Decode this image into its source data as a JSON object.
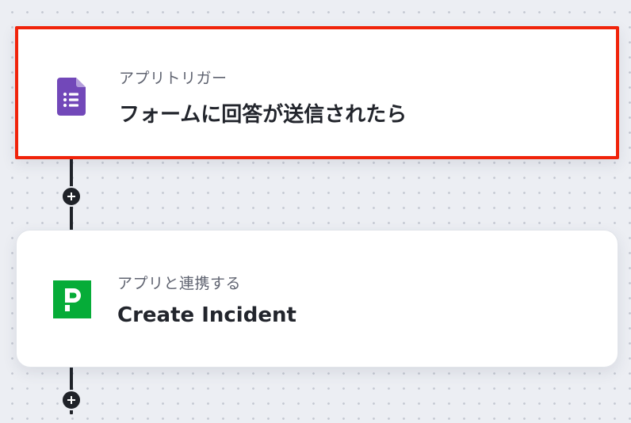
{
  "workflow": {
    "steps": [
      {
        "subtitle": "アプリトリガー",
        "title": "フォームに回答が送信されたら",
        "icon": "google-forms-icon",
        "icon_color": "#7248b9",
        "highlight_color": "#f0230a"
      },
      {
        "subtitle": "アプリと連携する",
        "title": "Create Incident",
        "icon": "pagerduty-icon",
        "icon_color": "#06ac38"
      }
    ],
    "add_button_icon": "plus-icon",
    "connector_color": "#1f2228"
  }
}
